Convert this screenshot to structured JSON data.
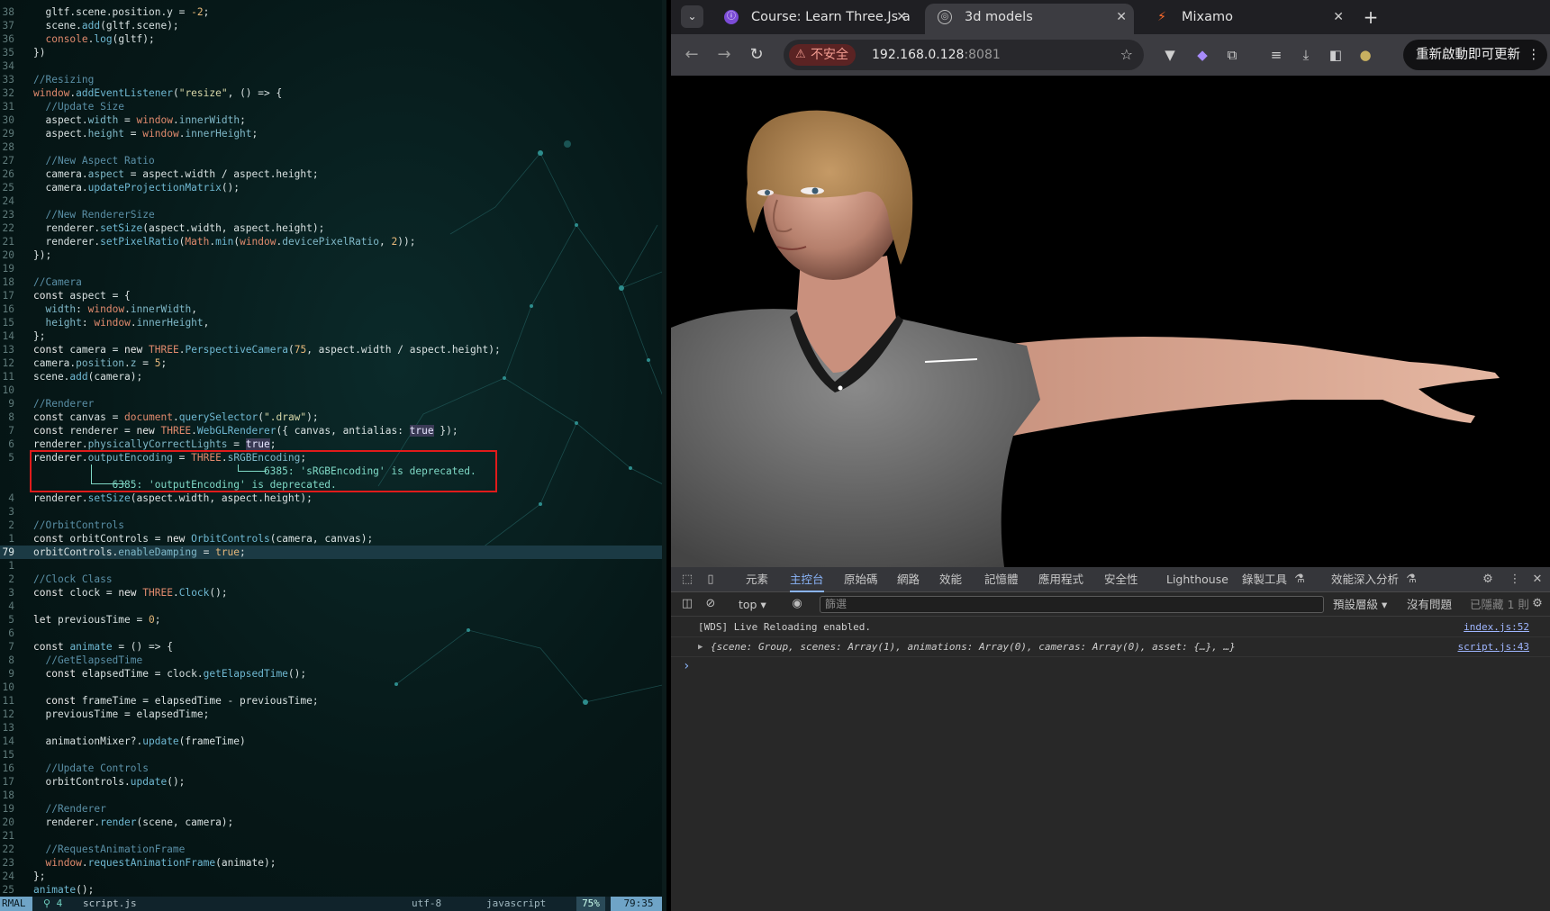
{
  "editor": {
    "lines": [
      {
        "n": "38",
        "code": [
          [
            "p",
            "  gltf.scene.position.y = "
          ],
          [
            "num",
            "-2"
          ],
          [
            "p",
            ";"
          ]
        ]
      },
      {
        "n": "37",
        "code": [
          [
            "p",
            "  scene."
          ],
          [
            "fn",
            "add"
          ],
          [
            "p",
            "(gltf.scene);"
          ]
        ]
      },
      {
        "n": "36",
        "code": [
          [
            "p",
            "  "
          ],
          [
            "red",
            "console"
          ],
          [
            "p",
            "."
          ],
          [
            "fn",
            "log"
          ],
          [
            "p",
            "(gltf);"
          ]
        ]
      },
      {
        "n": "35",
        "code": [
          [
            "p",
            "})"
          ]
        ]
      },
      {
        "n": "34",
        "code": []
      },
      {
        "n": "33",
        "code": [
          [
            "cm",
            "//Resizing"
          ]
        ]
      },
      {
        "n": "32",
        "code": [
          [
            "red",
            "window"
          ],
          [
            "p",
            "."
          ],
          [
            "fn",
            "addEventListener"
          ],
          [
            "p",
            "("
          ],
          [
            "str",
            "\"resize\""
          ],
          [
            "p",
            ", () => {"
          ]
        ]
      },
      {
        "n": "31",
        "code": [
          [
            "cm",
            "  //Update Size"
          ]
        ]
      },
      {
        "n": "30",
        "code": [
          [
            "p",
            "  aspect."
          ],
          [
            "prop",
            "width"
          ],
          [
            "p",
            " = "
          ],
          [
            "red",
            "window"
          ],
          [
            "p",
            "."
          ],
          [
            "prop",
            "innerWidth"
          ],
          [
            "p",
            ";"
          ]
        ]
      },
      {
        "n": "29",
        "code": [
          [
            "p",
            "  aspect."
          ],
          [
            "prop",
            "height"
          ],
          [
            "p",
            " = "
          ],
          [
            "red",
            "window"
          ],
          [
            "p",
            "."
          ],
          [
            "prop",
            "innerHeight"
          ],
          [
            "p",
            ";"
          ]
        ]
      },
      {
        "n": "28",
        "code": []
      },
      {
        "n": "27",
        "code": [
          [
            "cm",
            "  //New Aspect Ratio"
          ]
        ]
      },
      {
        "n": "26",
        "code": [
          [
            "p",
            "  camera."
          ],
          [
            "prop",
            "aspect"
          ],
          [
            "p",
            " = aspect.width / aspect.height;"
          ]
        ]
      },
      {
        "n": "25",
        "code": [
          [
            "p",
            "  camera."
          ],
          [
            "fn",
            "updateProjectionMatrix"
          ],
          [
            "p",
            "();"
          ]
        ]
      },
      {
        "n": "24",
        "code": []
      },
      {
        "n": "23",
        "code": [
          [
            "cm",
            "  //New RendererSize"
          ]
        ]
      },
      {
        "n": "22",
        "code": [
          [
            "p",
            "  renderer."
          ],
          [
            "fn",
            "setSize"
          ],
          [
            "p",
            "(aspect.width, aspect.height);"
          ]
        ]
      },
      {
        "n": "21",
        "code": [
          [
            "p",
            "  renderer."
          ],
          [
            "fn",
            "setPixelRatio"
          ],
          [
            "p",
            "("
          ],
          [
            "red",
            "Math"
          ],
          [
            "p",
            "."
          ],
          [
            "fn",
            "min"
          ],
          [
            "p",
            "("
          ],
          [
            "red",
            "window"
          ],
          [
            "p",
            "."
          ],
          [
            "prop",
            "devicePixelRatio"
          ],
          [
            "p",
            ", "
          ],
          [
            "num",
            "2"
          ],
          [
            "p",
            "));"
          ]
        ]
      },
      {
        "n": "20",
        "code": [
          [
            "p",
            "});"
          ]
        ]
      },
      {
        "n": "19",
        "code": []
      },
      {
        "n": "18",
        "code": [
          [
            "cm",
            "//Camera"
          ]
        ]
      },
      {
        "n": "17",
        "code": [
          [
            "kw",
            "const"
          ],
          [
            "p",
            " aspect = {"
          ]
        ]
      },
      {
        "n": "16",
        "code": [
          [
            "p",
            "  "
          ],
          [
            "prop",
            "width"
          ],
          [
            "p",
            ": "
          ],
          [
            "red",
            "window"
          ],
          [
            "p",
            "."
          ],
          [
            "prop",
            "innerWidth"
          ],
          [
            "p",
            ","
          ]
        ]
      },
      {
        "n": "15",
        "code": [
          [
            "p",
            "  "
          ],
          [
            "prop",
            "height"
          ],
          [
            "p",
            ": "
          ],
          [
            "red",
            "window"
          ],
          [
            "p",
            "."
          ],
          [
            "prop",
            "innerHeight"
          ],
          [
            "p",
            ","
          ]
        ]
      },
      {
        "n": "14",
        "code": [
          [
            "p",
            "};"
          ]
        ]
      },
      {
        "n": "13",
        "code": [
          [
            "kw",
            "const"
          ],
          [
            "p",
            " camera = "
          ],
          [
            "kw",
            "new"
          ],
          [
            "p",
            " "
          ],
          [
            "red",
            "THREE"
          ],
          [
            "p",
            "."
          ],
          [
            "fn",
            "PerspectiveCamera"
          ],
          [
            "p",
            "("
          ],
          [
            "num",
            "75"
          ],
          [
            "p",
            ", aspect.width / aspect.height);"
          ]
        ]
      },
      {
        "n": "12",
        "code": [
          [
            "p",
            "camera."
          ],
          [
            "prop",
            "position"
          ],
          [
            "p",
            "."
          ],
          [
            "prop",
            "z"
          ],
          [
            "p",
            " = "
          ],
          [
            "num",
            "5"
          ],
          [
            "p",
            ";"
          ]
        ]
      },
      {
        "n": "11",
        "code": [
          [
            "p",
            "scene."
          ],
          [
            "fn",
            "add"
          ],
          [
            "p",
            "(camera);"
          ]
        ]
      },
      {
        "n": "10",
        "code": []
      },
      {
        "n": "9",
        "code": [
          [
            "cm",
            "//Renderer"
          ]
        ]
      },
      {
        "n": "8",
        "code": [
          [
            "kw",
            "const"
          ],
          [
            "p",
            " canvas = "
          ],
          [
            "red",
            "document"
          ],
          [
            "p",
            "."
          ],
          [
            "fn",
            "querySelector"
          ],
          [
            "p",
            "("
          ],
          [
            "str",
            "\".draw\""
          ],
          [
            "p",
            ");"
          ]
        ]
      },
      {
        "n": "7",
        "code": [
          [
            "kw",
            "const"
          ],
          [
            "p",
            " renderer = "
          ],
          [
            "kw",
            "new"
          ],
          [
            "p",
            " "
          ],
          [
            "red",
            "THREE"
          ],
          [
            "p",
            "."
          ],
          [
            "fn",
            "WebGLRenderer"
          ],
          [
            "p",
            "({ canvas, antialias: "
          ],
          [
            "bool",
            "true"
          ],
          [
            "p",
            " });"
          ]
        ]
      },
      {
        "n": "6",
        "code": [
          [
            "p",
            "renderer."
          ],
          [
            "prop",
            "physicallyCorrectLights"
          ],
          [
            "p",
            " = "
          ],
          [
            "bool",
            "true"
          ],
          [
            "p",
            ";"
          ]
        ]
      },
      {
        "n": "5",
        "code": [
          [
            "p",
            "renderer."
          ],
          [
            "prop",
            "outputEncoding"
          ],
          [
            "p",
            " = "
          ],
          [
            "red",
            "THREE"
          ],
          [
            "p",
            "."
          ],
          [
            "prop",
            "sRGBEncoding"
          ],
          [
            "p",
            ";"
          ]
        ]
      },
      {
        "n": "",
        "code": [
          [
            "diag",
            "                                      6385: 'sRGBEncoding' is deprecated."
          ]
        ]
      },
      {
        "n": "",
        "code": [
          [
            "diag",
            "             6385: 'outputEncoding' is deprecated."
          ]
        ]
      },
      {
        "n": "4",
        "code": [
          [
            "p",
            "renderer."
          ],
          [
            "fn",
            "setSize"
          ],
          [
            "p",
            "(aspect.width, aspect.height);"
          ]
        ]
      },
      {
        "n": "3",
        "code": []
      },
      {
        "n": "2",
        "code": [
          [
            "cm",
            "//OrbitControls"
          ]
        ]
      },
      {
        "n": "1",
        "code": [
          [
            "kw",
            "const"
          ],
          [
            "p",
            " orbitControls = "
          ],
          [
            "kw",
            "new"
          ],
          [
            "p",
            " "
          ],
          [
            "fn",
            "OrbitControls"
          ],
          [
            "p",
            "(camera, canvas);"
          ]
        ]
      },
      {
        "n": "79",
        "cur": true,
        "code": [
          [
            "p",
            "orbitControls."
          ],
          [
            "prop",
            "enableDamping"
          ],
          [
            "p",
            " = "
          ],
          [
            "num",
            "true"
          ],
          [
            "p",
            ";"
          ]
        ]
      },
      {
        "n": "1",
        "code": []
      },
      {
        "n": "2",
        "code": [
          [
            "cm",
            "//Clock Class"
          ]
        ]
      },
      {
        "n": "3",
        "code": [
          [
            "kw",
            "const"
          ],
          [
            "p",
            " clock = "
          ],
          [
            "kw",
            "new"
          ],
          [
            "p",
            " "
          ],
          [
            "red",
            "THREE"
          ],
          [
            "p",
            "."
          ],
          [
            "fn",
            "Clock"
          ],
          [
            "p",
            "();"
          ]
        ]
      },
      {
        "n": "4",
        "code": []
      },
      {
        "n": "5",
        "code": [
          [
            "kw",
            "let"
          ],
          [
            "p",
            " previousTime = "
          ],
          [
            "num",
            "0"
          ],
          [
            "p",
            ";"
          ]
        ]
      },
      {
        "n": "6",
        "code": []
      },
      {
        "n": "7",
        "code": [
          [
            "kw",
            "const"
          ],
          [
            "p",
            " "
          ],
          [
            "fn",
            "animate"
          ],
          [
            "p",
            " = () => {"
          ]
        ]
      },
      {
        "n": "8",
        "code": [
          [
            "cm",
            "  //GetElapsedTime"
          ]
        ]
      },
      {
        "n": "9",
        "code": [
          [
            "p",
            "  "
          ],
          [
            "kw",
            "const"
          ],
          [
            "p",
            " elapsedTime = clock."
          ],
          [
            "fn",
            "getElapsedTime"
          ],
          [
            "p",
            "();"
          ]
        ]
      },
      {
        "n": "10",
        "code": []
      },
      {
        "n": "11",
        "code": [
          [
            "p",
            "  "
          ],
          [
            "kw",
            "const"
          ],
          [
            "p",
            " frameTime = elapsedTime - previousTime;"
          ]
        ]
      },
      {
        "n": "12",
        "code": [
          [
            "p",
            "  previousTime = elapsedTime;"
          ]
        ]
      },
      {
        "n": "13",
        "code": []
      },
      {
        "n": "14",
        "code": [
          [
            "p",
            "  animationMixer?."
          ],
          [
            "fn",
            "update"
          ],
          [
            "p",
            "(frameTime)"
          ]
        ]
      },
      {
        "n": "15",
        "code": []
      },
      {
        "n": "16",
        "code": [
          [
            "cm",
            "  //Update Controls"
          ]
        ]
      },
      {
        "n": "17",
        "code": [
          [
            "p",
            "  orbitControls."
          ],
          [
            "fn",
            "update"
          ],
          [
            "p",
            "();"
          ]
        ]
      },
      {
        "n": "18",
        "code": []
      },
      {
        "n": "19",
        "code": [
          [
            "cm",
            "  //Renderer"
          ]
        ]
      },
      {
        "n": "20",
        "code": [
          [
            "p",
            "  renderer."
          ],
          [
            "fn",
            "render"
          ],
          [
            "p",
            "(scene, camera);"
          ]
        ]
      },
      {
        "n": "21",
        "code": []
      },
      {
        "n": "22",
        "code": [
          [
            "cm",
            "  //RequestAnimationFrame"
          ]
        ]
      },
      {
        "n": "23",
        "code": [
          [
            "p",
            "  "
          ],
          [
            "red",
            "window"
          ],
          [
            "p",
            "."
          ],
          [
            "fn",
            "requestAnimationFrame"
          ],
          [
            "p",
            "(animate);"
          ]
        ]
      },
      {
        "n": "24",
        "code": [
          [
            "p",
            "};"
          ]
        ]
      },
      {
        "n": "25",
        "code": [
          [
            "fn",
            "animate"
          ],
          [
            "p",
            "();"
          ]
        ]
      }
    ],
    "status": {
      "mode": "RMAL",
      "diagnostics": "⚲ 4",
      "filename": "script.js",
      "encoding": "utf-8",
      "filetype": "javascript",
      "percent": "75%",
      "position": "79:35"
    }
  },
  "browser": {
    "tabs": [
      {
        "title": "Course: Learn Three.Js a",
        "icon": "course-icon"
      },
      {
        "title": "3d models",
        "icon": "globe-icon"
      },
      {
        "title": "Mixamo",
        "icon": "mixamo-icon"
      }
    ],
    "insecure_label": "不安全",
    "url_host": "192.168.0.128",
    "url_port": ":8081",
    "update_button": "重新啟動即可更新"
  },
  "devtools": {
    "tabs": [
      "元素",
      "主控台",
      "原始碼",
      "網路",
      "效能",
      "記憶體",
      "應用程式",
      "安全性",
      "Lighthouse",
      "錄製工具",
      "效能深入分析"
    ],
    "active_tab": "主控台",
    "context": "top",
    "filter_placeholder": "篩選",
    "levels": "預設層級",
    "issues": "沒有問題",
    "hidden": "已隱藏 1 則",
    "messages": [
      {
        "text": "[WDS] Live Reloading enabled.",
        "source": "index.js:52"
      },
      {
        "text": "{scene: Group, scenes: Array(1), animations: Array(0), cameras: Array(0), asset: {…}, …}",
        "source": "script.js:43"
      }
    ]
  },
  "colors": {
    "active_tab": "#8ab4f8",
    "diag_box": "#e01b1b"
  }
}
